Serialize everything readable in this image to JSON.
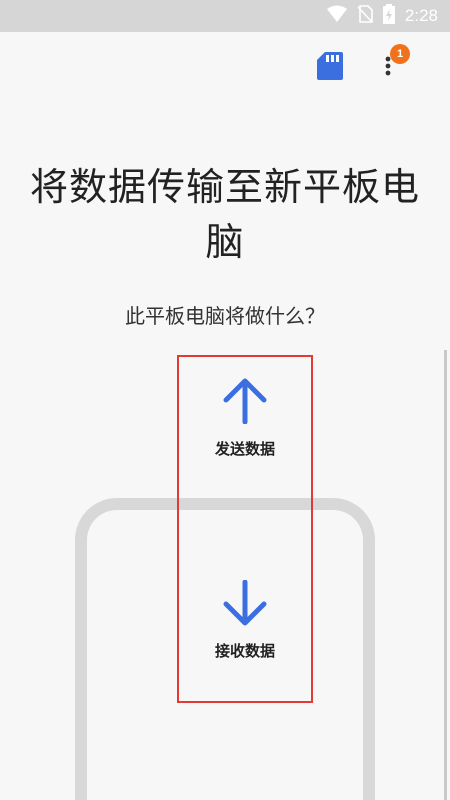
{
  "status_bar": {
    "time": "2:28",
    "icons": [
      "wifi-icon",
      "no-sim-icon",
      "battery-charging-icon"
    ]
  },
  "toolbar": {
    "sd_card_icon": "sd-card-icon",
    "more_icon": "more-vert-icon",
    "notification_count": "1",
    "badge_color": "#f0731c",
    "accent_color": "#3b6fe0"
  },
  "main": {
    "title": "将数据传输至新平板电脑",
    "question": "此平板电脑将做什么？"
  },
  "options": {
    "send": {
      "label": "发送数据",
      "icon": "arrow-up-icon"
    },
    "receive": {
      "label": "接收数据",
      "icon": "arrow-down-icon"
    }
  },
  "highlight_color": "#e53935"
}
